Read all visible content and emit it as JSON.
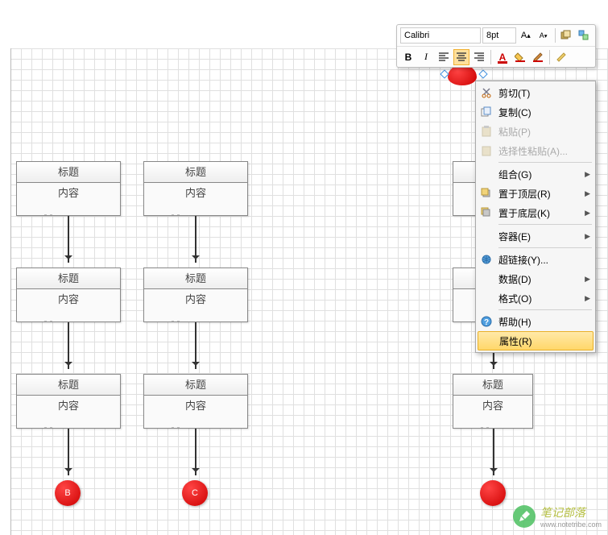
{
  "toolbar": {
    "font_name": "Calibri",
    "font_size": "8pt"
  },
  "shapes": {
    "title_label": "标题",
    "body_label": "内容"
  },
  "circles": {
    "b": "B",
    "c": "C"
  },
  "context_menu": {
    "cut": "剪切(T)",
    "copy": "复制(C)",
    "paste": "粘贴(P)",
    "paste_special": "选择性粘贴(A)...",
    "group": "组合(G)",
    "bring_front": "置于顶层(R)",
    "send_back": "置于底层(K)",
    "container": "容器(E)",
    "hyperlink": "超链接(Y)...",
    "data": "数据(D)",
    "format": "格式(O)",
    "help": "帮助(H)",
    "properties": "属性(R)"
  },
  "watermark": {
    "title": "笔记部落",
    "subtitle": "www.notetribe.com"
  }
}
